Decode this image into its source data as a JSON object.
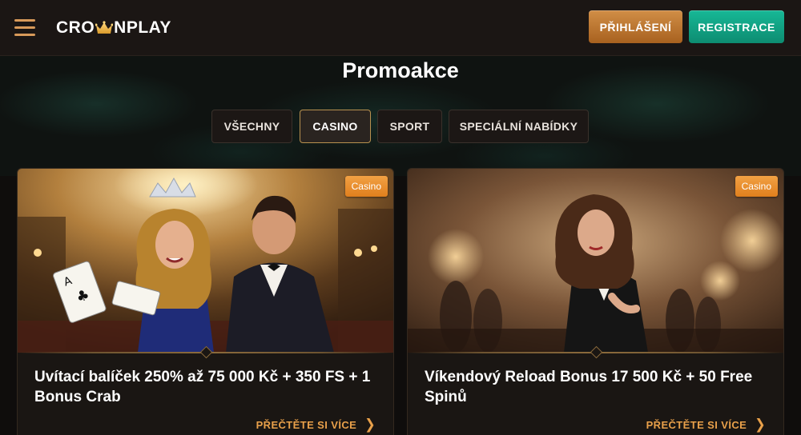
{
  "header": {
    "logo_left": "CRO",
    "logo_right": "NPLAY",
    "login_label": "PŘIHLÁŠENÍ",
    "register_label": "REGISTRACE",
    "menu_icon": "hamburger-menu-icon",
    "logo_icon": "crown-icon"
  },
  "page": {
    "title": "Promoakce"
  },
  "tabs": [
    {
      "label": "VŠECHNY",
      "active": false
    },
    {
      "label": "CASINO",
      "active": true
    },
    {
      "label": "SPORT",
      "active": false
    },
    {
      "label": "SPECIÁLNÍ NABÍDKY",
      "active": false
    }
  ],
  "cards": [
    {
      "badge": "Casino",
      "title": "Uvítací balíček 250% až 75 000 Kč + 350 FS + 1 Bonus Crab",
      "more_label": "PŘEČTĚTE SI VÍCE",
      "more_icon": "chevron-right-icon"
    },
    {
      "badge": "Casino",
      "title": "Víkendový Reload Bonus 17 500 Kč + 50 Free Spinů",
      "more_label": "PŘEČTĚTE SI VÍCE",
      "more_icon": "chevron-right-icon"
    }
  ],
  "colors": {
    "accent_gold": "#e8a04a",
    "login_button": "#c27a33",
    "register_button": "#12a887",
    "badge": "#eb8f2e",
    "header_bg": "#1b1614"
  }
}
